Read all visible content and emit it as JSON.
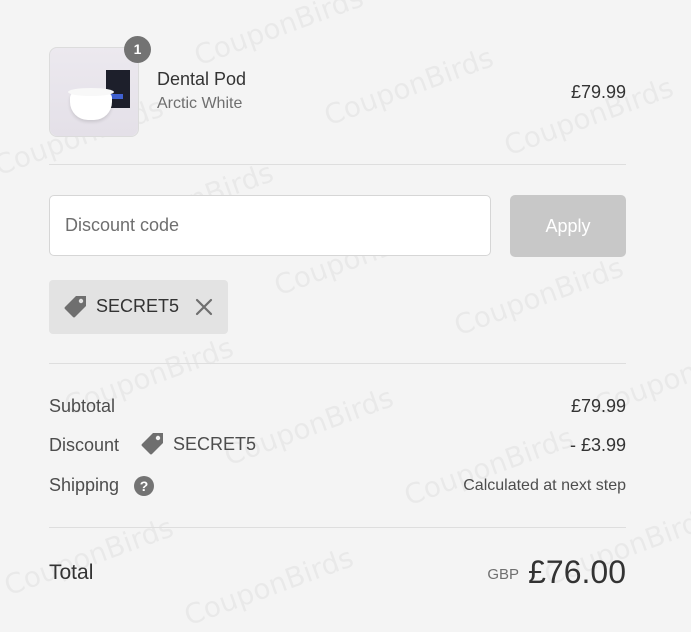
{
  "product": {
    "name": "Dental Pod",
    "variant": "Arctic White",
    "price": "£79.99",
    "quantity": "1"
  },
  "discount": {
    "placeholder": "Discount code",
    "apply_label": "Apply",
    "applied_code": "SECRET5",
    "tag_icon": "tag-icon",
    "remove_icon": "close-icon"
  },
  "summary": {
    "subtotal_label": "Subtotal",
    "subtotal_value": "£79.99",
    "discount_label": "Discount",
    "discount_code": "SECRET5",
    "discount_value": "- £3.99",
    "shipping_label": "Shipping",
    "shipping_help_icon": "?",
    "shipping_value": "Calculated at next step"
  },
  "total": {
    "label": "Total",
    "currency": "GBP",
    "amount": "£76.00"
  },
  "watermark": {
    "text": "CouponBirds"
  },
  "colors": {
    "background": "#f4f4f4",
    "apply_button": "#c8c8c8",
    "chip": "#e3e3e3",
    "badge": "#737373"
  }
}
